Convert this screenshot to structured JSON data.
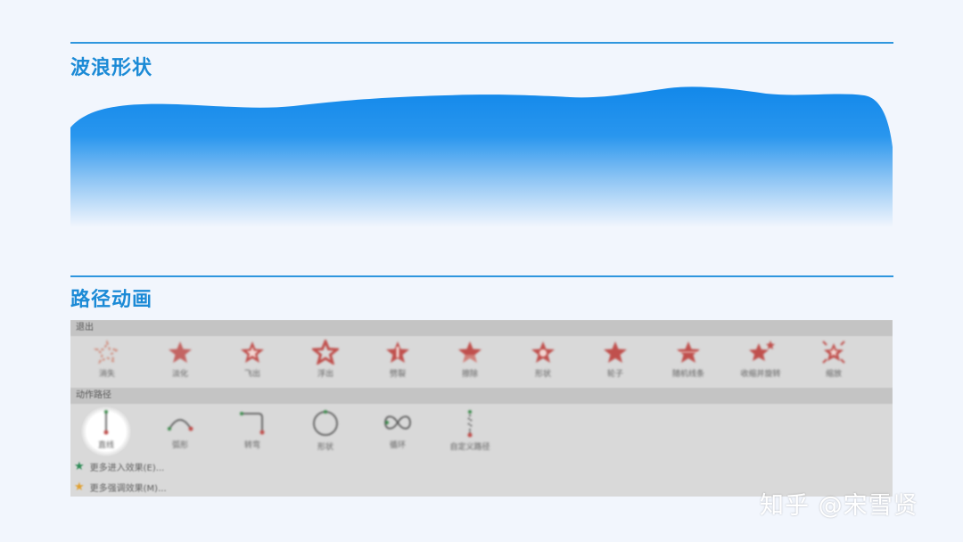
{
  "section1": {
    "title": "波浪形状"
  },
  "section2": {
    "title": "路径动画"
  },
  "panel": {
    "exit_header": "退出",
    "exit_effects": [
      {
        "label": "消失",
        "icon": "burst-outline-icon"
      },
      {
        "label": "淡化",
        "icon": "star-faded-icon"
      },
      {
        "label": "飞出",
        "icon": "star-fly-out-icon"
      },
      {
        "label": "浮出",
        "icon": "star-outline-icon"
      },
      {
        "label": "劈裂",
        "icon": "star-split-icon"
      },
      {
        "label": "擦除",
        "icon": "star-wipe-icon"
      },
      {
        "label": "形状",
        "icon": "star-shape-icon"
      },
      {
        "label": "轮子",
        "icon": "star-wheel-icon"
      },
      {
        "label": "随机线条",
        "icon": "star-random-bars-icon"
      },
      {
        "label": "收缩并旋转",
        "icon": "star-spin-icon"
      },
      {
        "label": "缩放",
        "icon": "star-zoom-icon"
      }
    ],
    "motion_header": "动作路径",
    "motion_paths": [
      {
        "label": "直线",
        "icon": "line-path-icon"
      },
      {
        "label": "弧形",
        "icon": "arc-path-icon"
      },
      {
        "label": "转弯",
        "icon": "turn-path-icon"
      },
      {
        "label": "形状",
        "icon": "circle-path-icon"
      },
      {
        "label": "循环",
        "icon": "loop-path-icon"
      },
      {
        "label": "自定义路径",
        "icon": "custom-path-icon"
      }
    ],
    "more_entrance": "更多进入效果(E)...",
    "more_emphasis": "更多强调效果(M)..."
  },
  "watermark": "知乎 @宋雪贤",
  "colors": {
    "accent": "#1b8ad6",
    "rule": "#2f96de",
    "wave_top": "#1288ea",
    "effect_red": "#c0504d",
    "more_entrance_star": "#2e8b57",
    "more_emphasis_star": "#e0a030"
  }
}
